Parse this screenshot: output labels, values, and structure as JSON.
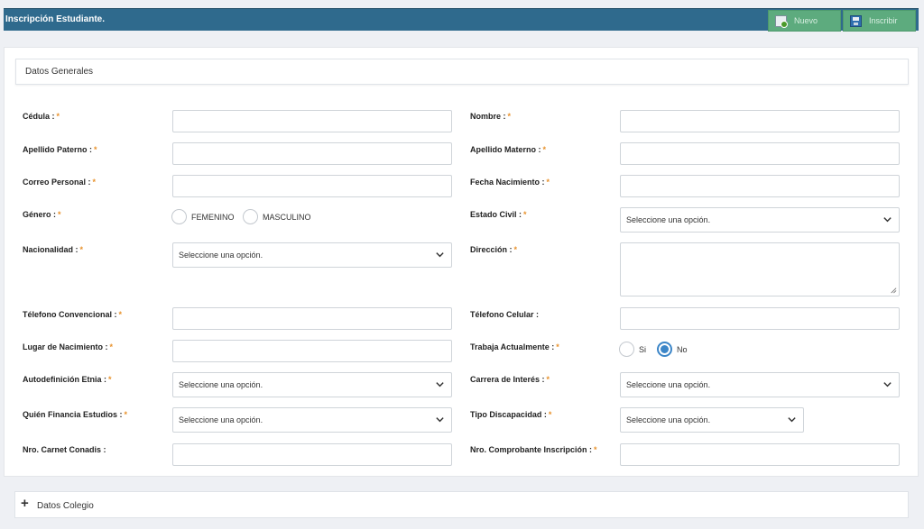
{
  "header": {
    "title": "Inscripción Estudiante.",
    "btn_nuevo": "Nuevo",
    "btn_inscribir": "Inscribir"
  },
  "sections": {
    "datos_generales": "Datos Generales",
    "datos_colegio": "Datos Colegio"
  },
  "required_mark": "*",
  "labels": {
    "cedula": "Cédula :",
    "nombre": "Nombre :",
    "apellido_paterno": "Apellido Paterno :",
    "apellido_materno": "Apellido Materno :",
    "correo_personal": "Correo Personal :",
    "fecha_nacimiento": "Fecha Nacimiento :",
    "genero": "Género :",
    "estado_civil": "Estado Civil :",
    "nacionalidad": "Nacionalidad :",
    "direccion": "Dirección :",
    "telefono_convencional": "Télefono Convencional :",
    "telefono_celular": "Télefono Celular :",
    "lugar_nacimiento": "Lugar de Nacimiento :",
    "trabaja_actualmente": "Trabaja Actualmente :",
    "autodefinicion_etnia": "Autodefinición Etnia :",
    "carrera_interes": "Carrera de Interés :",
    "quien_financia": "Quién Financia Estudios :",
    "tipo_discapacidad": "Tipo Discapacidad :",
    "carnet_conadis": "Nro. Carnet Conadis :",
    "comprobante_inscripcion": "Nro. Comprobante Inscripción :"
  },
  "genero_options": [
    "FEMENINO",
    "MASCULINO"
  ],
  "trabaja_options": [
    "Si",
    "No"
  ],
  "trabaja_selected": "No",
  "select_placeholder": "Seleccione una opción.",
  "icons": {
    "nuevo": "new-document-icon",
    "inscribir": "save-icon",
    "select": "chevron-down-icon",
    "expand": "plus-icon"
  },
  "colors": {
    "header_bg": "#2f6a8d",
    "button_bg": "#5dab7e",
    "required": "#e8922c",
    "radio_checked": "#3c86c8"
  }
}
